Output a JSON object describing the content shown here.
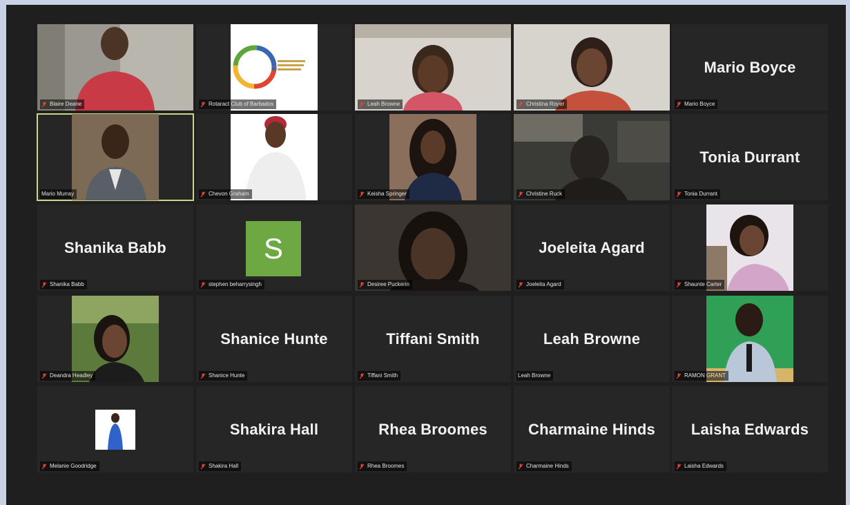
{
  "participants": [
    {
      "display": "",
      "label": "Blaire Deane",
      "muted": true
    },
    {
      "display": "",
      "label": "Rotaract Club of Barbados",
      "muted": true
    },
    {
      "display": "",
      "label": "Leah Browne",
      "muted": true
    },
    {
      "display": "",
      "label": "Christina Royer",
      "muted": true
    },
    {
      "display": "Mario Boyce",
      "label": "Mario Boyce",
      "muted": true
    },
    {
      "display": "",
      "label": "Mario Murray",
      "muted": false
    },
    {
      "display": "",
      "label": "Chevon Graham",
      "muted": true
    },
    {
      "display": "",
      "label": "Keisha Springer",
      "muted": true
    },
    {
      "display": "",
      "label": "Christine Ruck",
      "muted": true
    },
    {
      "display": "Tonia Durrant",
      "label": "Tonia Durrant",
      "muted": true
    },
    {
      "display": "Shanika Babb",
      "label": "Shanika Babb",
      "muted": true
    },
    {
      "display": "S",
      "label": "stephen beharrysingh",
      "muted": true
    },
    {
      "display": "",
      "label": "Desiree Puckerin",
      "muted": true
    },
    {
      "display": "Joeleita Agard",
      "label": "Joeleita Agard",
      "muted": true
    },
    {
      "display": "",
      "label": "Shaunte Carter",
      "muted": true
    },
    {
      "display": "",
      "label": "Deandra Headley",
      "muted": true
    },
    {
      "display": "Shanice Hunte",
      "label": "Shanice Hunte",
      "muted": true
    },
    {
      "display": "Tiffani Smith",
      "label": "Tiffani Smith",
      "muted": true
    },
    {
      "display": "Leah Browne",
      "label": "Leah Browne",
      "muted": false
    },
    {
      "display": "",
      "label": "RAMON GRANT",
      "muted": true
    },
    {
      "display": "",
      "label": "Melanie Goodridge",
      "muted": true
    },
    {
      "display": "Shakira Hall",
      "label": "Shakira Hall",
      "muted": true
    },
    {
      "display": "Rhea Broomes",
      "label": "Rhea Broomes",
      "muted": true
    },
    {
      "display": "Charmaine Hinds",
      "label": "Charmaine Hinds",
      "muted": true
    },
    {
      "display": "Laisha Edwards",
      "label": "Laisha Edwards",
      "muted": true
    }
  ],
  "colors": {
    "background": "#1f1f1f",
    "tile": "#262626",
    "active_speaker_border": "#c8d88a",
    "muted_icon": "#e0453a",
    "avatar_initial_bg": "#6ea843"
  },
  "icons": {
    "muted": "microphone-muted-icon"
  }
}
